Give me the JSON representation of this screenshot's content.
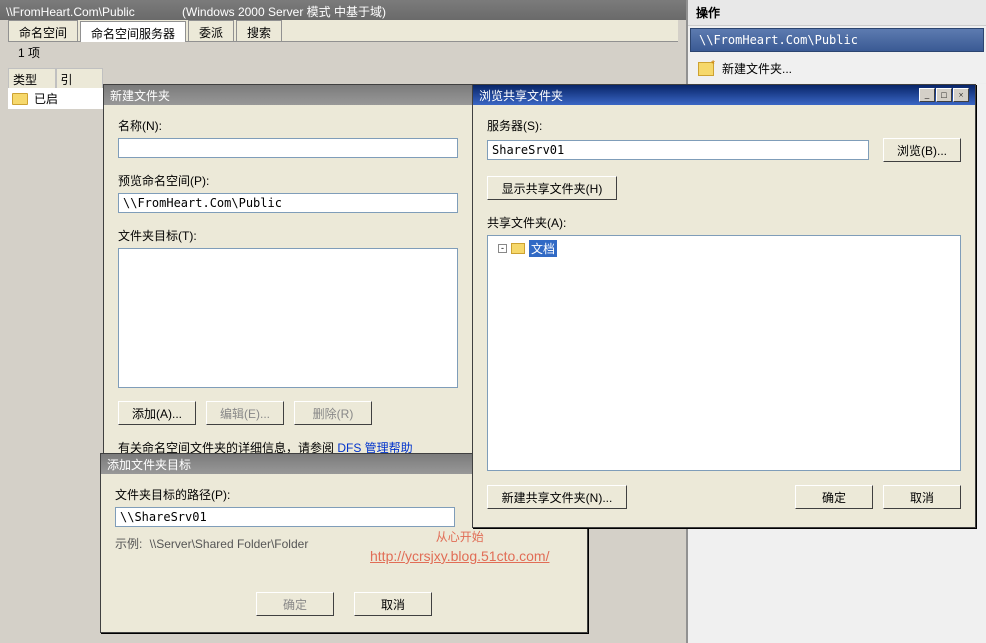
{
  "main": {
    "path": "\\\\FromHeart.Com\\Public",
    "mode": "(Windows 2000 Server 模式 中基于域)"
  },
  "tabs": {
    "namespace": "命名空间",
    "servers": "命名空间服务器",
    "delegation": "委派",
    "search": "搜索"
  },
  "itemCount": "1 项",
  "listCols": {
    "type": "类型",
    "ref": "引"
  },
  "listRow": {
    "status": "已启"
  },
  "actions": {
    "title": "操作",
    "sub": "\\\\FromHeart.Com\\Public",
    "newFolder": "新建文件夹..."
  },
  "dlgNewFolder": {
    "title": "新建文件夹",
    "nameLabel": "名称(N):",
    "nameValue": "",
    "previewLabel": "预览命名空间(P):",
    "previewValue": "\\\\FromHeart.Com\\Public",
    "targetLabel": "文件夹目标(T):",
    "add": "添加(A)...",
    "edit": "编辑(E)...",
    "delete": "删除(R)",
    "helpPrefix": "有关命名空间文件夹的详细信息，请参阅 ",
    "helpLink": "DFS 管理帮助"
  },
  "dlgAddTarget": {
    "title": "添加文件夹目标",
    "pathLabel": "文件夹目标的路径(P):",
    "pathValue": "\\\\ShareSrv01",
    "exampleLabel": "示例:",
    "exampleValue": "\\\\Server\\Shared Folder\\Folder",
    "ok": "确定",
    "cancel": "取消"
  },
  "dlgBrowse": {
    "title": "浏览共享文件夹",
    "serverLabel": "服务器(S):",
    "serverValue": "ShareSrv01",
    "browse": "浏览(B)...",
    "showShares": "显示共享文件夹(H)",
    "sharesLabel": "共享文件夹(A):",
    "treeItem": "文档",
    "newShare": "新建共享文件夹(N)...",
    "ok": "确定",
    "cancel": "取消"
  },
  "watermark": {
    "line1": "从心开始",
    "line2": "http://ycrsjxy.blog.51cto.com/"
  }
}
